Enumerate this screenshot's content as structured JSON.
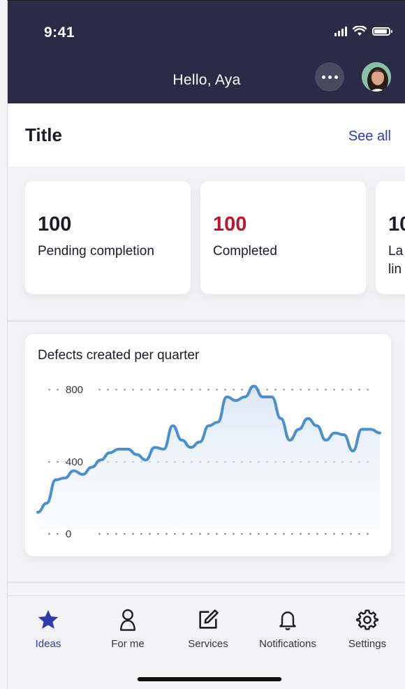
{
  "status_bar": {
    "time": "9:41"
  },
  "header": {
    "greeting": "Hello, Aya",
    "more_icon": "ellipsis-icon",
    "avatar_icon": "user-avatar"
  },
  "section": {
    "title": "Title",
    "see_all": "See all"
  },
  "cards": [
    {
      "value": "100",
      "label": "Pending completion",
      "value_color": "#1c1c24"
    },
    {
      "value": "100",
      "label": "Completed",
      "value_color": "#c0142a"
    },
    {
      "value": "10",
      "label": "La\nlin",
      "value_color": "#1c1c24"
    }
  ],
  "chart_card": {
    "title": "Defects created per quarter"
  },
  "chart_data": {
    "type": "area",
    "title": "Defects created per quarter",
    "xlabel": "",
    "ylabel": "",
    "ylim": [
      0,
      800
    ],
    "y_ticks": [
      0,
      400,
      800
    ],
    "y_tick_labels": [
      "0",
      "400",
      "800"
    ],
    "grid": true,
    "series": [
      {
        "values": [
          120,
          170,
          300,
          310,
          350,
          330,
          370,
          410,
          450,
          470,
          470,
          440,
          410,
          480,
          470,
          600,
          520,
          480,
          510,
          600,
          620,
          760,
          740,
          760,
          820,
          760,
          760,
          640,
          520,
          580,
          640,
          600,
          520,
          560,
          550,
          460,
          580,
          580,
          560
        ]
      }
    ],
    "line_color": "#4a8fd0"
  },
  "tabs": [
    {
      "label": "Ideas",
      "icon": "star-icon",
      "active": true
    },
    {
      "label": "For me",
      "icon": "person-icon",
      "active": false
    },
    {
      "label": "Services",
      "icon": "edit-icon",
      "active": false
    },
    {
      "label": "Notifications",
      "icon": "bell-icon",
      "active": false
    },
    {
      "label": "Settings",
      "icon": "gear-icon",
      "active": false
    }
  ],
  "colors": {
    "header_bg": "#2b2a47",
    "accent": "#2d3bb1",
    "alert": "#c0142a"
  }
}
